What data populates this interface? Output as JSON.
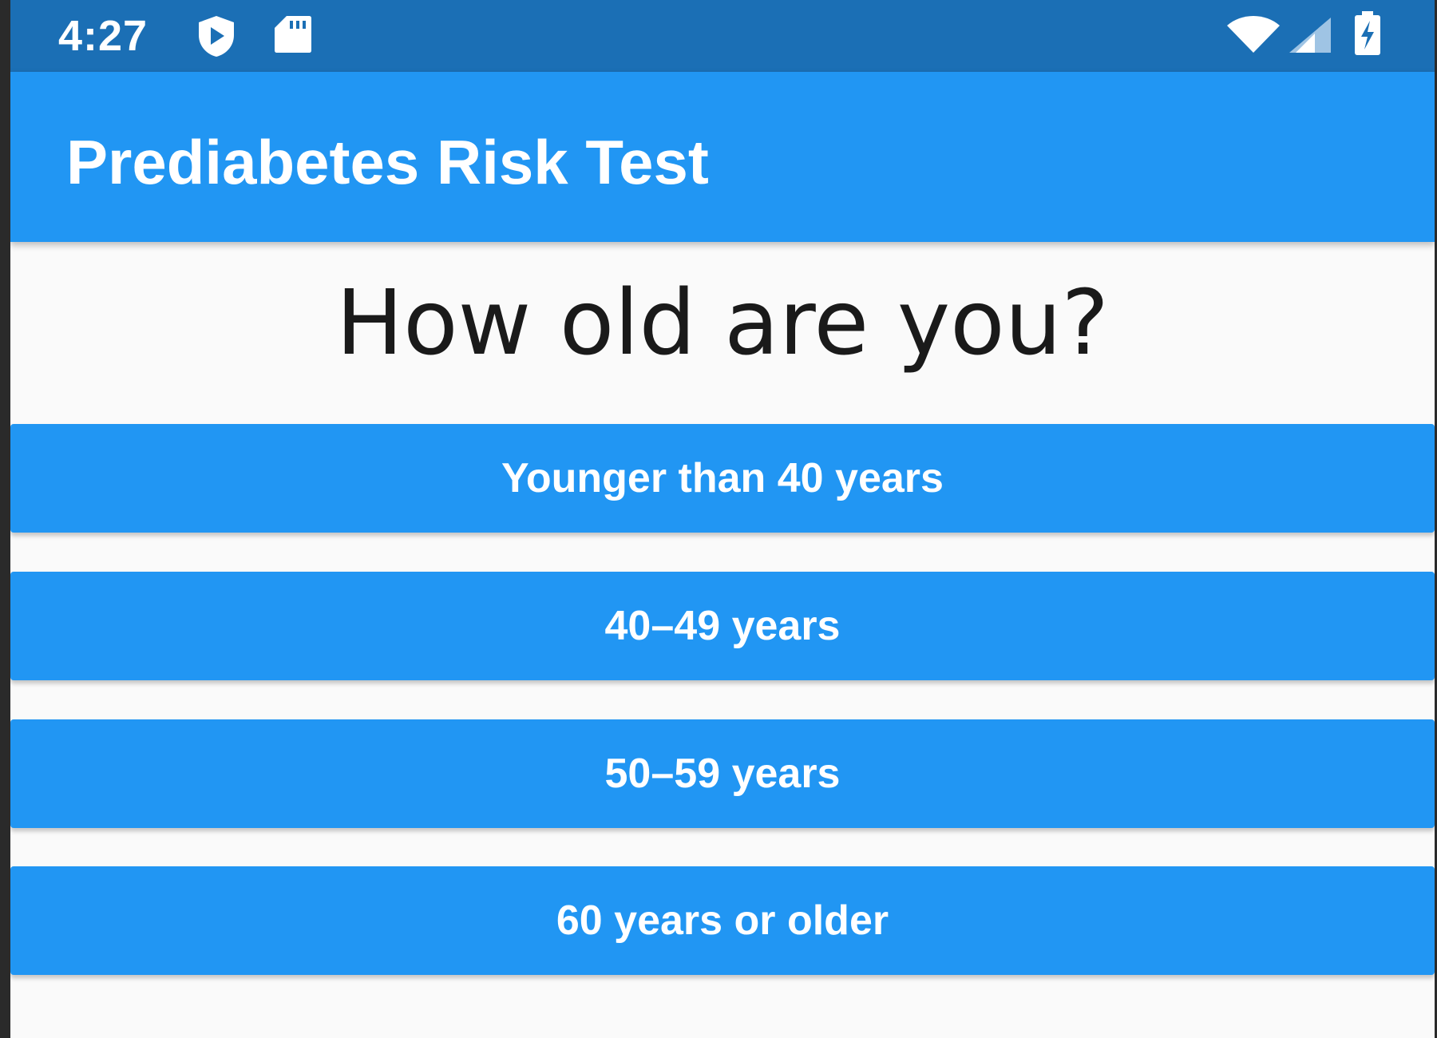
{
  "status_bar": {
    "time": "4:27",
    "icons": [
      "play-protect-icon",
      "sd-card-icon",
      "wifi-icon",
      "cell-signal-icon",
      "battery-charging-icon"
    ]
  },
  "app_bar": {
    "title": "Prediabetes Risk Test"
  },
  "question": {
    "text": "How old are you?"
  },
  "answers": [
    {
      "label": "Younger than 40 years"
    },
    {
      "label": "40–49 years"
    },
    {
      "label": "50–59 years"
    },
    {
      "label": "60 years or older"
    }
  ],
  "colors": {
    "status_bar": "#1b6fb5",
    "primary": "#2196f3",
    "background": "#fafafa",
    "text_dark": "#1a1a1a"
  }
}
